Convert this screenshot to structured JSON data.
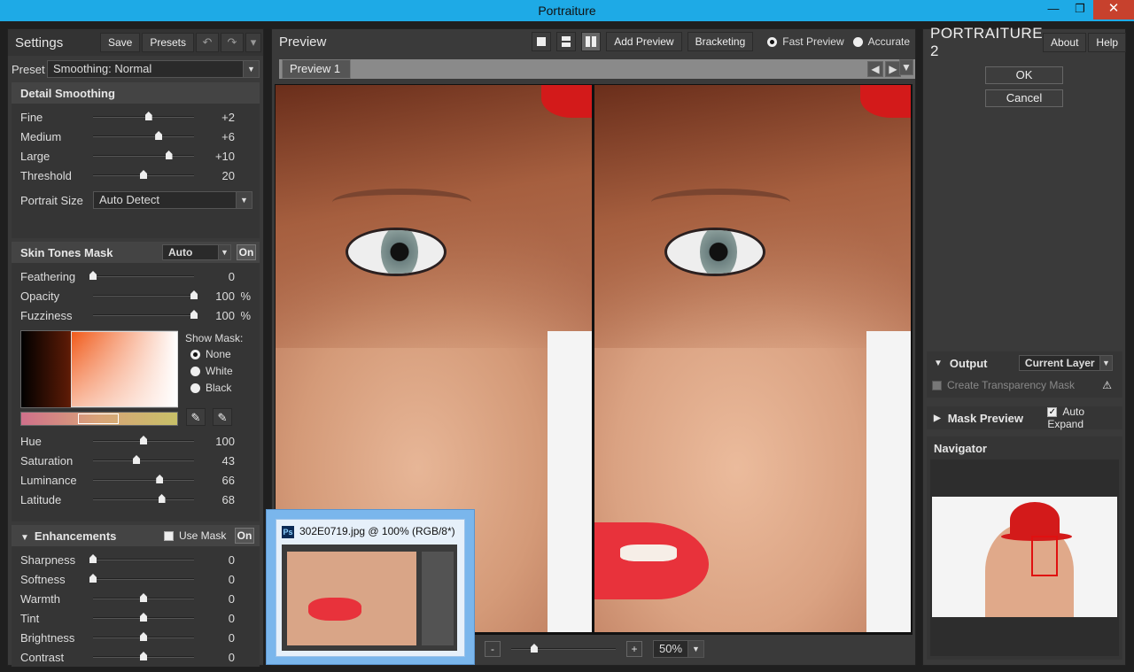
{
  "window": {
    "title": "Portraiture"
  },
  "left": {
    "title": "Settings",
    "save": "Save",
    "presets": "Presets",
    "preset_label": "Preset",
    "preset_value": "Smoothing: Normal",
    "detail": {
      "title": "Detail Smoothing",
      "rows": [
        {
          "name": "Fine",
          "value": "+2",
          "pos": 0.55
        },
        {
          "name": "Medium",
          "value": "+6",
          "pos": 0.65
        },
        {
          "name": "Large",
          "value": "+10",
          "pos": 0.75
        },
        {
          "name": "Threshold",
          "value": "20",
          "pos": 0.5
        }
      ],
      "portrait_size_label": "Portrait Size",
      "portrait_size_value": "Auto Detect"
    },
    "skin": {
      "title": "Skin Tones Mask",
      "mode": "Auto",
      "on": "On",
      "rows": [
        {
          "name": "Feathering",
          "value": "0",
          "unit": "",
          "pos": 0
        },
        {
          "name": "Opacity",
          "value": "100",
          "unit": "%",
          "pos": 1
        },
        {
          "name": "Fuzziness",
          "value": "100",
          "unit": "%",
          "pos": 1
        }
      ],
      "show_mask_label": "Show Mask:",
      "mask_options": [
        "None",
        "White",
        "Black"
      ],
      "mask_selected": "None",
      "hsl_rows": [
        {
          "name": "Hue",
          "value": "100",
          "pos": 0.5
        },
        {
          "name": "Saturation",
          "value": "43",
          "pos": 0.43
        },
        {
          "name": "Luminance",
          "value": "66",
          "pos": 0.66
        },
        {
          "name": "Latitude",
          "value": "68",
          "pos": 0.68
        }
      ]
    },
    "enh": {
      "title": "Enhancements",
      "use_mask": "Use Mask",
      "on": "On",
      "rows": [
        {
          "name": "Sharpness",
          "value": "0",
          "pos": 0
        },
        {
          "name": "Softness",
          "value": "0",
          "pos": 0
        },
        {
          "name": "Warmth",
          "value": "0",
          "pos": 0.5
        },
        {
          "name": "Tint",
          "value": "0",
          "pos": 0.5
        },
        {
          "name": "Brightness",
          "value": "0",
          "pos": 0.5
        },
        {
          "name": "Contrast",
          "value": "0",
          "pos": 0.5
        }
      ]
    }
  },
  "center": {
    "title": "Preview",
    "add_preview": "Add Preview",
    "bracketing": "Bracketing",
    "fast_preview": "Fast Preview",
    "accurate": "Accurate",
    "tab": "Preview 1",
    "zoom": "50%",
    "zoom_minus": "-",
    "zoom_plus": "+",
    "zoom_pos": 0.22
  },
  "right": {
    "brand": "PORTRAITURE 2",
    "about": "About",
    "help": "Help",
    "ok": "OK",
    "cancel": "Cancel",
    "output": "Output",
    "output_value": "Current Layer",
    "transparency": "Create Transparency Mask",
    "mask_preview": "Mask Preview",
    "auto_expand": "Auto Expand",
    "navigator": "Navigator"
  },
  "popup": {
    "caption": "302E0719.jpg @ 100% (RGB/8*)",
    "app_icon": "Ps"
  }
}
